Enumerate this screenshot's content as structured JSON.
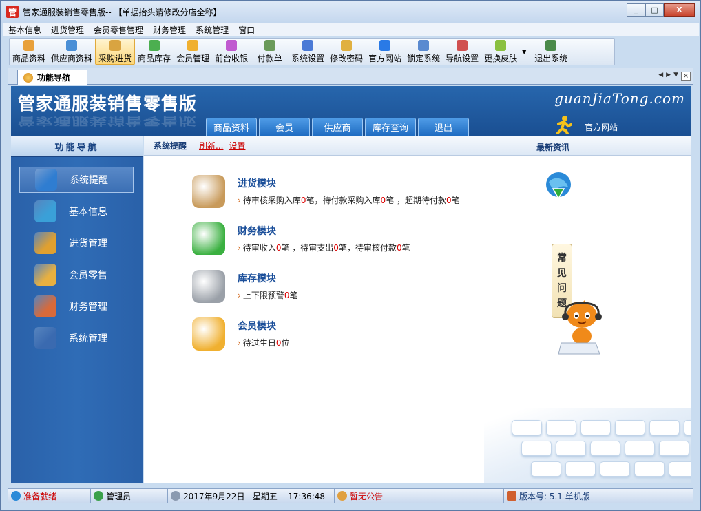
{
  "window": {
    "app_icon_char": "管",
    "title": "管家通服装销售零售版-- 【单据抬头请修改分店全称】",
    "buttons": {
      "minimize": "_",
      "maximize": "□",
      "close": "X"
    }
  },
  "menubar": [
    "基本信息",
    "进货管理",
    "会员零售管理",
    "财务管理",
    "系统管理",
    "窗口"
  ],
  "toolbar": {
    "group1": [
      {
        "label": "商品资料",
        "icon": "goods-icon",
        "color": "#e8a03a"
      },
      {
        "label": "供应商资料",
        "icon": "supplier-icon",
        "color": "#4a8fd6"
      },
      {
        "label": "采购进货",
        "icon": "purchase-icon",
        "color": "#d9a441",
        "active": true
      },
      {
        "label": "商品库存",
        "icon": "stock-icon",
        "color": "#4caf50"
      },
      {
        "label": "会员管理",
        "icon": "member-icon",
        "color": "#f0b030"
      },
      {
        "label": "前台收银",
        "icon": "cashier-icon",
        "color": "#c05ad0"
      },
      {
        "label": "付款单",
        "icon": "payment-icon",
        "color": "#6a9a5a"
      },
      {
        "label": "系统设置",
        "icon": "settings-icon",
        "color": "#4a7ad6"
      },
      {
        "label": "修改密码",
        "icon": "password-icon",
        "color": "#e0b040"
      },
      {
        "label": "官方网站",
        "icon": "ie-icon",
        "color": "#2a7ae6"
      },
      {
        "label": "锁定系统",
        "icon": "lock-icon",
        "color": "#5a8ad0"
      },
      {
        "label": "导航设置",
        "icon": "nav-settings-icon",
        "color": "#d05050"
      },
      {
        "label": "更换皮肤",
        "icon": "skin-icon",
        "color": "#8ac040"
      }
    ],
    "group2": [
      {
        "label": "退出系统",
        "icon": "exit-icon",
        "color": "#4a8a4a"
      }
    ]
  },
  "doc_tab": {
    "label": "功能导航"
  },
  "banner": {
    "title": "管家通服装销售零售版",
    "brand": "guanJiaTong.com",
    "tabs": [
      "商品资料",
      "会员",
      "供应商",
      "库存查询",
      "退出"
    ],
    "website_link": "官方网站"
  },
  "sidebar": {
    "header": "功能导航",
    "items": [
      {
        "label": "系统提醒",
        "icon": "info-icon",
        "color": "#2f7dd1",
        "selected": true
      },
      {
        "label": "基本信息",
        "icon": "cubes-icon",
        "color": "#3aa0d8"
      },
      {
        "label": "进货管理",
        "icon": "box-in-icon",
        "color": "#e0a030"
      },
      {
        "label": "会员零售",
        "icon": "box-member-icon",
        "color": "#e8b040"
      },
      {
        "label": "财务管理",
        "icon": "finance-icon",
        "color": "#d86a3a"
      },
      {
        "label": "系统管理",
        "icon": "monitor-icon",
        "color": "#3a6ab0"
      }
    ]
  },
  "content": {
    "header_title": "系统提醒",
    "refresh_link": "刷新...",
    "settings_link": "设置",
    "news_title": "最新资讯",
    "modules": [
      {
        "title": "进货模块",
        "icon": "purchase-module-icon",
        "color": "#c89a5a",
        "parts": [
          "待审核采购入库",
          "0",
          "笔，待付款采购入库",
          "0",
          "笔 ，超期待付款",
          "0",
          "笔"
        ]
      },
      {
        "title": "财务模块",
        "icon": "dollar-icon",
        "color": "#3ab040",
        "parts": [
          "待审收入",
          "0",
          "笔 ，待审支出",
          "0",
          "笔，待审核付款",
          "0",
          "笔"
        ]
      },
      {
        "title": "库存模块",
        "icon": "database-icon",
        "color": "#9aa0a8",
        "parts": [
          "上下限预警",
          "0",
          "笔"
        ]
      },
      {
        "title": "会员模块",
        "icon": "chat-bubble-icon",
        "color": "#f0b030",
        "parts": [
          "待过生日",
          "0",
          "位"
        ]
      }
    ],
    "faq": [
      "常",
      "见",
      "问",
      "题"
    ]
  },
  "statusbar": {
    "ready": "准备就绪",
    "user": "管理员",
    "datetime": "2017年9月22日   星期五    17:36:48",
    "notice": "暂无公告",
    "version": "版本号: 5.1 单机版"
  }
}
